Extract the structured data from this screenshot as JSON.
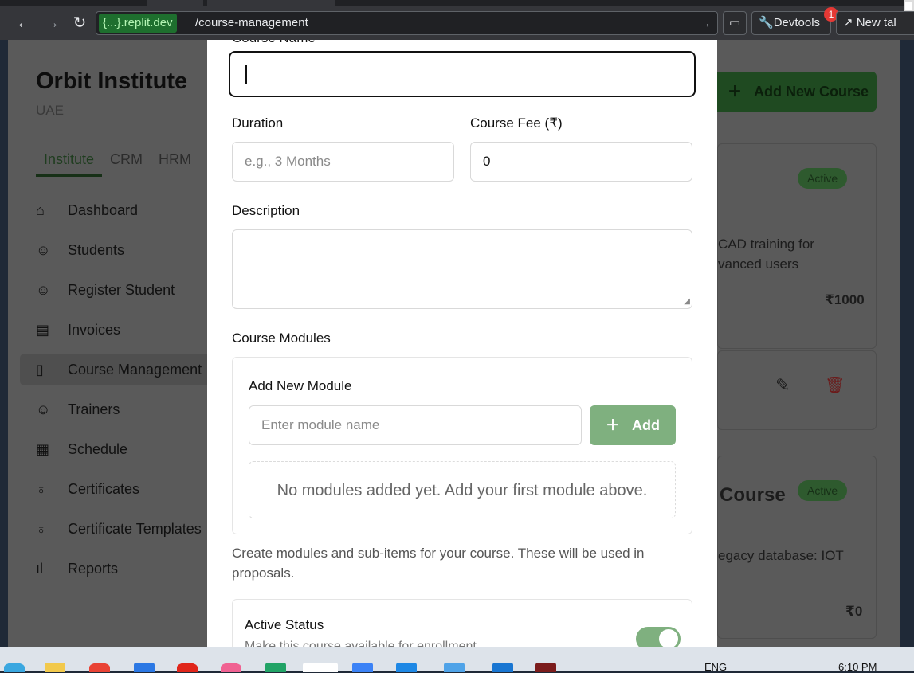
{
  "browser": {
    "url_chip": "{...}.replit.dev",
    "url_path": "/course-management",
    "devtools_label": "Devtools",
    "devtools_badge": "1",
    "new_tab_label": "New tal"
  },
  "background": {
    "institute_name": "Orbit Institute",
    "institute_location": "UAE",
    "tabs": [
      "Institute",
      "CRM",
      "HRM"
    ],
    "sidebar": [
      {
        "label": "Dashboard",
        "icon": "home-icon"
      },
      {
        "label": "Students",
        "icon": "users-icon"
      },
      {
        "label": "Register Student",
        "icon": "user-plus-icon"
      },
      {
        "label": "Invoices",
        "icon": "file-icon"
      },
      {
        "label": "Course Management",
        "icon": "book-icon"
      },
      {
        "label": "Trainers",
        "icon": "user-cog-icon"
      },
      {
        "label": "Schedule",
        "icon": "calendar-icon"
      },
      {
        "label": "Certificates",
        "icon": "award-icon"
      },
      {
        "label": "Certificate Templates",
        "icon": "award-icon"
      },
      {
        "label": "Reports",
        "icon": "bar-chart-icon"
      }
    ],
    "add_course_button": "Add New Course",
    "card1": {
      "badge": "Active",
      "desc_line1": "CAD training for",
      "desc_line2": "vanced users",
      "fee": "₹1000"
    },
    "card2": {
      "title_fragment": "Course",
      "badge": "Active",
      "desc": "egacy database: IOT",
      "fee": "₹0"
    }
  },
  "modal": {
    "course_name_label": "Course Name",
    "course_name_value": "",
    "duration_label": "Duration",
    "duration_placeholder": "e.g., 3 Months",
    "fee_label": "Course Fee (₹)",
    "fee_value": "0",
    "description_label": "Description",
    "modules_label": "Course Modules",
    "add_module_heading": "Add New Module",
    "module_input_placeholder": "Enter module name",
    "add_button": "Add",
    "empty_modules": "No modules added yet. Add your first module above.",
    "modules_help": "Create modules and sub-items for your course. These will be used in proposals.",
    "status_label": "Active Status",
    "status_sub": "Make this course available for enrollment",
    "status_on": true
  },
  "taskbar": {
    "language": "ENG",
    "time": "6:10 PM"
  },
  "colors": {
    "accent_green": "#7fb07f",
    "dark_green": "#1f4a21"
  }
}
